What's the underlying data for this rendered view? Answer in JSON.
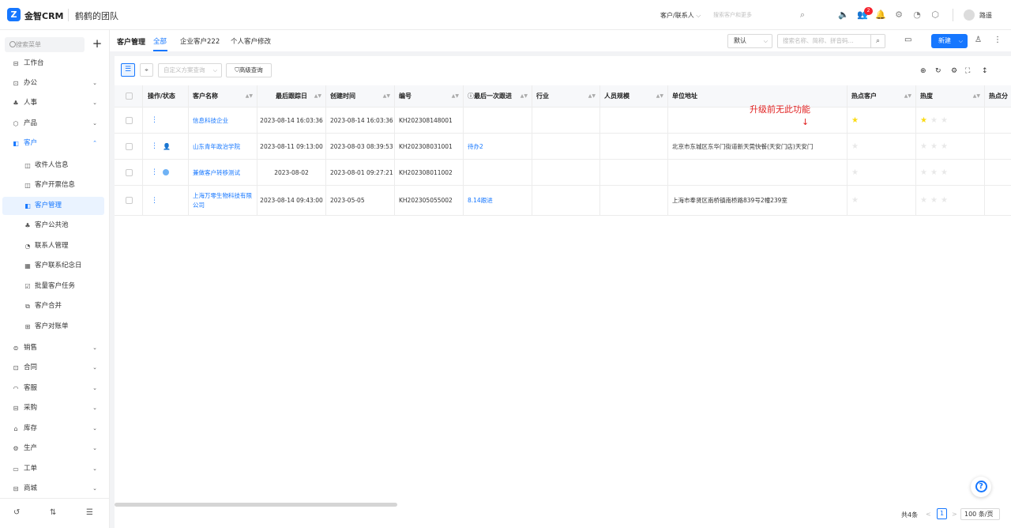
{
  "header": {
    "brand": "金智CRM",
    "logo_letter": "Z",
    "team": "鹤鹤的团队",
    "search_scope": "客户/联系人",
    "search_placeholder": "搜索客户和更多",
    "notification_count": "2",
    "user_name": "路遥"
  },
  "sidebar": {
    "search_placeholder": "搜索菜单",
    "add_label": "+",
    "items": [
      {
        "label": "工作台"
      },
      {
        "label": "办公"
      },
      {
        "label": "人事"
      },
      {
        "label": "产品"
      },
      {
        "label": "客户"
      },
      {
        "label": "收件人信息"
      },
      {
        "label": "客户开票信息"
      },
      {
        "label": "客户管理"
      },
      {
        "label": "客户公共池"
      },
      {
        "label": "联系人管理"
      },
      {
        "label": "客户联系纪念日"
      },
      {
        "label": "批量客户任务"
      },
      {
        "label": "客户合并"
      },
      {
        "label": "客户对账单"
      },
      {
        "label": "销售"
      },
      {
        "label": "合同"
      },
      {
        "label": "客服"
      },
      {
        "label": "采购"
      },
      {
        "label": "库存"
      },
      {
        "label": "生产"
      },
      {
        "label": "工单"
      },
      {
        "label": "商城"
      }
    ]
  },
  "page": {
    "title": "客户管理",
    "tabs": [
      "全部",
      "企业客户222",
      "个人客户修改"
    ],
    "view_select": "默认",
    "search_placeholder": "搜索名称、简称、拼音码...",
    "new_label": "新建",
    "plan_placeholder": "自定义方案查询",
    "advanced_query": "高级查询"
  },
  "table": {
    "columns": [
      "操作/状态",
      "客户名称",
      "最后跟踪日",
      "创建时间",
      "编号",
      "最后一次跟进",
      "行业",
      "人员规模",
      "单位地址",
      "热点客户",
      "热度",
      "热点分"
    ],
    "rows": [
      {
        "name": "信息科技企业",
        "last_track": "2023-08-14 16:03:36",
        "created": "2023-08-14 16:03:36",
        "code": "KH202308148001",
        "followup": "",
        "address": "",
        "hot_stars": 1,
        "heat_stars": 1
      },
      {
        "name": "山东青年政治学院",
        "last_track": "2023-08-11 09:13:00",
        "created": "2023-08-03 08:39:53",
        "code": "KH202308031001",
        "followup": "待办2",
        "address": "北京市东城区东华门街道新天莞快餐(天安门店)天安门",
        "hot_stars": 0,
        "heat_stars": 0
      },
      {
        "name": "兼做客户转移测试",
        "last_track": "2023-08-02",
        "created": "2023-08-01 09:27:21",
        "code": "KH202308011002",
        "followup": "",
        "address": "",
        "hot_stars": 0,
        "heat_stars": 0
      },
      {
        "name": "上海万零生物科技有限公司",
        "last_track": "2023-08-14 09:43:00",
        "created": "2023-05-05",
        "code": "KH202305055002",
        "followup": "8.14跟进",
        "address": "上海市奉贤区南桥镇南桥路839号2幢239室",
        "hot_stars": 0,
        "heat_stars": 0
      }
    ]
  },
  "annotation": {
    "text": "升级前无此功能",
    "arrow": "↓"
  },
  "pager": {
    "total": "共4条",
    "prev": "<",
    "page": "1",
    "next": ">",
    "page_size": "100 条/页"
  },
  "help_icon": "?"
}
